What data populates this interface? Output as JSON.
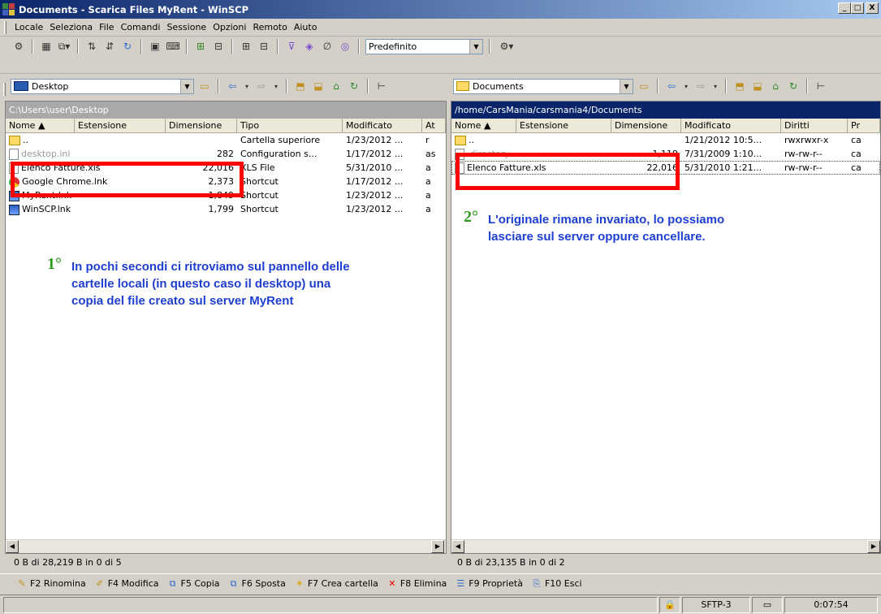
{
  "window": {
    "title": "Documents - Scarica Files MyRent - WinSCP",
    "controls": [
      "_",
      "□",
      "X"
    ]
  },
  "menu": [
    "Locale",
    "Seleziona",
    "File",
    "Comandi",
    "Sessione",
    "Opzioni",
    "Remoto",
    "Aiuto"
  ],
  "toolbar": {
    "transfer_preset": "Predefinito"
  },
  "local": {
    "location": "Desktop",
    "path": "C:\\Users\\user\\Desktop",
    "columns": [
      "Nome",
      "Estensione",
      "Dimensione",
      "Tipo",
      "Modificato",
      "At"
    ],
    "rows": [
      {
        "name": "..",
        "size": "",
        "type": "Cartella superiore",
        "modified": "1/23/2012 ...",
        "attr": "r"
      },
      {
        "name": "desktop.ini",
        "size": "282",
        "type": "Configuration s...",
        "modified": "1/17/2012 ...",
        "attr": "as"
      },
      {
        "name": "Elenco Fatture.xls",
        "size": "22,016",
        "type": "XLS File",
        "modified": "5/31/2010 ...",
        "attr": "a"
      },
      {
        "name": "Google Chrome.lnk",
        "size": "2,373",
        "type": "Shortcut",
        "modified": "1/17/2012 ...",
        "attr": "a"
      },
      {
        "name": "MyRent.lnk",
        "size": "1,849",
        "type": "Shortcut",
        "modified": "1/23/2012 ...",
        "attr": "a"
      },
      {
        "name": "WinSCP.lnk",
        "size": "1,799",
        "type": "Shortcut",
        "modified": "1/23/2012 ...",
        "attr": "a"
      }
    ],
    "status": "0 B di 28,219 B in 0 di 5"
  },
  "remote": {
    "location": "Documents",
    "path": "/home/CarsMania/carsmania4/Documents",
    "columns": [
      "Nome",
      "Estensione",
      "Dimensione",
      "Modificato",
      "Diritti",
      "Pr"
    ],
    "rows": [
      {
        "name": "..",
        "size": "",
        "modified": "1/21/2012 10:5...",
        "rights": "rwxrwxr-x",
        "owner": "ca"
      },
      {
        "name": ".directory",
        "size": "1,119",
        "modified": "7/31/2009 1:10...",
        "rights": "rw-rw-r--",
        "owner": "ca"
      },
      {
        "name": "Elenco Fatture.xls",
        "size": "22,016",
        "modified": "5/31/2010 1:21...",
        "rights": "rw-rw-r--",
        "owner": "ca"
      }
    ],
    "status": "0 B di 23,135 B in 0 di 2"
  },
  "annotations": {
    "one": {
      "num": "1°",
      "text": "In pochi secondi ci ritroviamo sul pannello delle cartelle locali (in questo caso il desktop) una copia del file creato sul server MyRent"
    },
    "two": {
      "num": "2°",
      "text": "L'originale rimane invariato, lo possiamo lasciare sul server oppure cancellare."
    }
  },
  "fkeys": [
    {
      "label": "F2 Rinomina",
      "icon": "rename-icon"
    },
    {
      "label": "F4 Modifica",
      "icon": "edit-icon"
    },
    {
      "label": "F5 Copia",
      "icon": "copy-icon"
    },
    {
      "label": "F6 Sposta",
      "icon": "move-icon"
    },
    {
      "label": "F7 Crea cartella",
      "icon": "new-folder-icon"
    },
    {
      "label": "F8 Elimina",
      "icon": "delete-icon"
    },
    {
      "label": "F9 Proprietà",
      "icon": "properties-icon"
    },
    {
      "label": "F10 Esci",
      "icon": "exit-icon"
    }
  ],
  "statusbar": {
    "protocol": "SFTP-3",
    "elapsed": "0:07:54"
  },
  "colors": {
    "title_start": "#0a246a",
    "title_end": "#a6caf0",
    "local_path_bg": "#a9a9a9",
    "remote_path_bg": "#0a246a",
    "highlight": "#ff0000",
    "annotation_text": "#1f3fd0",
    "annotation_num": "#2f9c1f"
  }
}
